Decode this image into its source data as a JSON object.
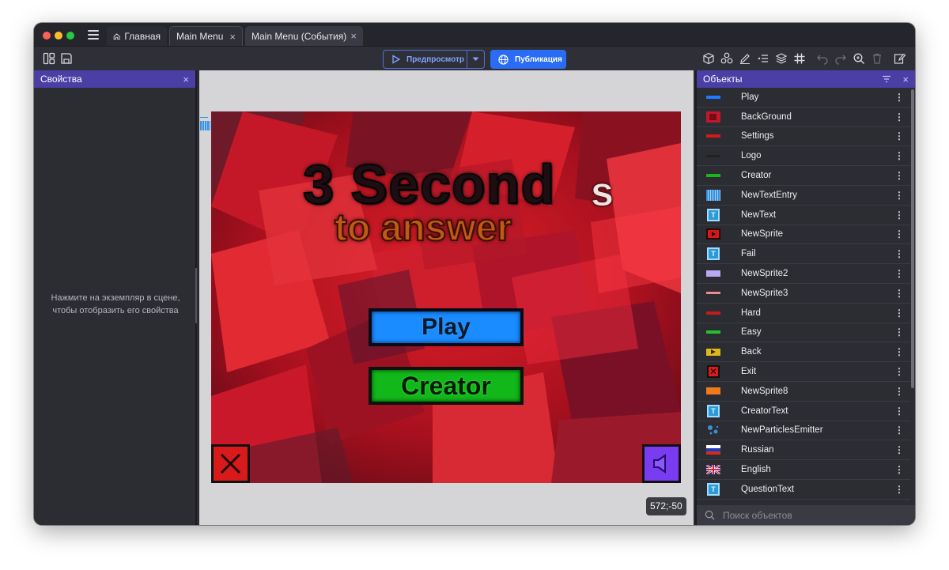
{
  "tabs": [
    {
      "label": "Главная",
      "icon": "home-icon",
      "active": false
    },
    {
      "label": "Main Menu",
      "active": true
    },
    {
      "label": "Main Menu (События)",
      "active": false
    }
  ],
  "toolbar": {
    "preview_label": "Предпросмотр",
    "publish_label": "Публикация"
  },
  "properties_panel": {
    "title": "Свойства",
    "hint_line1": "Нажмите на экземпляр в сцене,",
    "hint_line2": "чтобы отобразить его свойства"
  },
  "scene": {
    "title_line1": "3 Second",
    "title_s": "s",
    "title_line2": "to answer",
    "play_label": "Play",
    "creator_label": "Creator",
    "coordinates": "572;-50"
  },
  "objects_panel": {
    "title": "Объекты",
    "search_placeholder": "Поиск объектов",
    "items": [
      {
        "label": "Play",
        "thumb_color": "#1e7bff"
      },
      {
        "label": "BackGround",
        "thumb_color": "#c0182a"
      },
      {
        "label": "Settings",
        "thumb_color": "#d41a1a"
      },
      {
        "label": "Logo",
        "thumb_color": "#222222"
      },
      {
        "label": "Creator",
        "thumb_color": "#18b818"
      },
      {
        "label": "NewTextEntry",
        "thumb_color": "#3a8fd8"
      },
      {
        "label": "NewText",
        "thumb_color": "#2d9ad8"
      },
      {
        "label": "NewSprite",
        "thumb_color": "#d21a1a"
      },
      {
        "label": "Fail",
        "thumb_color": "#2d9ad8"
      },
      {
        "label": "NewSprite2",
        "thumb_color": "#b9a9f2"
      },
      {
        "label": "NewSprite3",
        "thumb_color": "#ef8a8a"
      },
      {
        "label": "Hard",
        "thumb_color": "#c81a1a"
      },
      {
        "label": "Easy",
        "thumb_color": "#22c32a"
      },
      {
        "label": "Back",
        "thumb_color": "#e0b81a"
      },
      {
        "label": "Exit",
        "thumb_color": "#e01a1a"
      },
      {
        "label": "NewSprite8",
        "thumb_color": "#f07b1a"
      },
      {
        "label": "CreatorText",
        "thumb_color": "#2d9ad8"
      },
      {
        "label": "NewParticlesEmitter",
        "thumb_color": "#3a8fd8"
      },
      {
        "label": "Russian",
        "thumb_color": "#d52b1e"
      },
      {
        "label": "English",
        "thumb_color": "#c8102e"
      },
      {
        "label": "QuestionText",
        "thumb_color": "#2d9ad8"
      }
    ]
  }
}
